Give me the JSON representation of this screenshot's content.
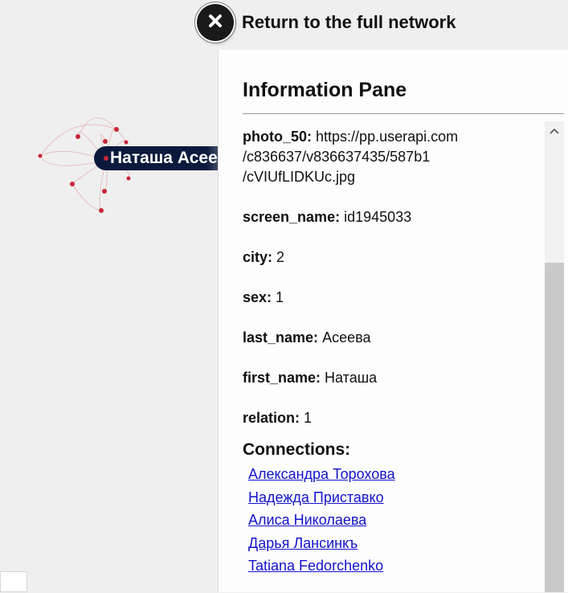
{
  "header": {
    "return_label": "Return to the full network"
  },
  "graph": {
    "node_label": "Наташа Асеева",
    "accent_color": "#c62837",
    "label_bg_color": "#0b1a3c"
  },
  "pane": {
    "title": "Information Pane",
    "fields": [
      {
        "key": "photo_50:",
        "value_lines": [
          "https://pp.userapi.com",
          "/c836637/v836637435/587b1",
          "/cVIUfLIDKUc.jpg"
        ]
      },
      {
        "key": "screen_name:",
        "value": "id1945033"
      },
      {
        "key": "city:",
        "value": "2"
      },
      {
        "key": "sex:",
        "value": "1"
      },
      {
        "key": "last_name:",
        "value": "Асеева"
      },
      {
        "key": "first_name:",
        "value": "Наташа"
      },
      {
        "key": "relation:",
        "value": "1"
      }
    ],
    "connections_title": "Connections:",
    "connections": [
      "Александра Торохова",
      "Надежда Приставко",
      "Алиса Николаева",
      "Дарья Лансинкъ",
      "Tatiana Fedorchenko"
    ]
  },
  "icons": {
    "close": "close-icon",
    "scroll_up": "chevron-up-icon"
  }
}
